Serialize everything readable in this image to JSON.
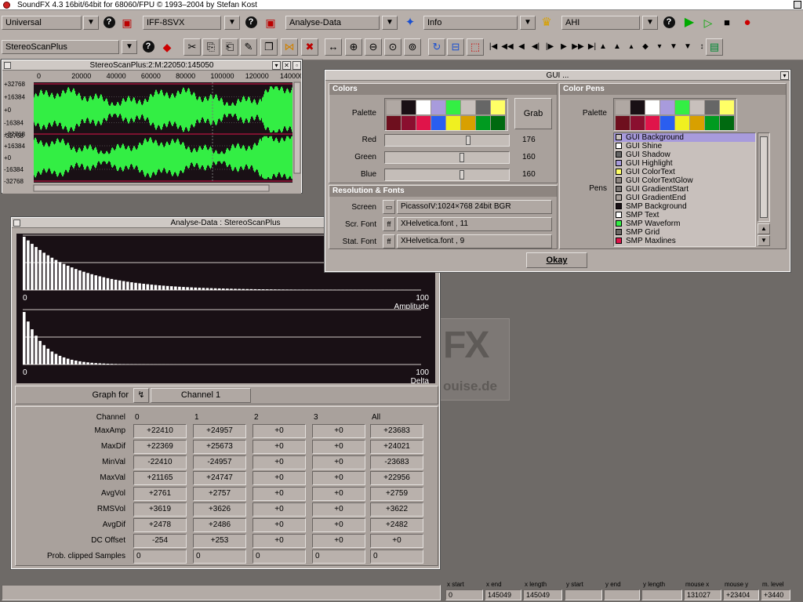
{
  "titlebar": {
    "title": "SoundFX  4.3 16bit/64bit for 68060/FPU © 1993–2004 by Stefan Kost"
  },
  "toolbar": {
    "universal": "Universal",
    "loader": "IFF-8SVX",
    "operator": "Analyse-Data",
    "info": "Info",
    "player": "AHI",
    "rexx": "StereoScanPlus"
  },
  "sample_window": {
    "title": "StereoScanPlus:2:M:22050:145050",
    "x_ticks": [
      "0",
      "20000",
      "40000",
      "60000",
      "80000",
      "100000",
      "120000",
      "140000"
    ],
    "y_ticks_ch1": [
      "+32768",
      "+16384",
      "+0",
      "-16384",
      "-32768"
    ],
    "y_ticks_ch2": [
      "+32768",
      "+16384",
      "+0",
      "-16384",
      "-32768"
    ],
    "waveform_color": "#33ee44"
  },
  "gui_window": {
    "title": "GUI ...",
    "colors": {
      "header": "Colors",
      "palette_label": "Palette",
      "grab_label": "Grab",
      "red_label": "Red",
      "red_value": "176",
      "red_level": 0.69,
      "green_label": "Green",
      "green_value": "160",
      "green_level": 0.63,
      "blue_label": "Blue",
      "blue_value": "160",
      "blue_level": 0.63
    },
    "palette": [
      "#b0a8a3",
      "#191015",
      "#ffffff",
      "#a89bdc",
      "#33ee44",
      "#c8c0bc",
      "#666666",
      "#ffff66",
      "#6e0f1e",
      "#8a0f2f",
      "#e0144a",
      "#2a5ef0",
      "#f0f020",
      "#d8a000",
      "#009b20",
      "#006a10"
    ],
    "resolution": {
      "header": "Resolution & Fonts",
      "screen_label": "Screen",
      "screen_value": "PicassoIV:1024×768 24bit BGR",
      "scr_font_label": "Scr. Font",
      "scr_font_value": "XHelvetica.font , 11",
      "stat_font_label": "Stat. Font",
      "stat_font_value": "XHelvetica.font , 9"
    },
    "color_pens": {
      "header": "Color Pens",
      "palette_label": "Palette",
      "pens_label": "Pens",
      "items": [
        {
          "name": "GUI Background",
          "color": "#c8c0bc"
        },
        {
          "name": "GUI Shine",
          "color": "#ffffff"
        },
        {
          "name": "GUI Shadow",
          "color": "#666666"
        },
        {
          "name": "GUI Highlight",
          "color": "#a89bdc"
        },
        {
          "name": "GUI ColorText",
          "color": "#ffff66"
        },
        {
          "name": "GUI ColorTextGlow",
          "color": "#8d8580"
        },
        {
          "name": "GUI GradientStart",
          "color": "#7a7572"
        },
        {
          "name": "GUI GradientEnd",
          "color": "#a9a19c"
        },
        {
          "name": "SMP Background",
          "color": "#191015"
        },
        {
          "name": "SMP Text",
          "color": "#ffffff"
        },
        {
          "name": "SMP Waveform",
          "color": "#33ee44"
        },
        {
          "name": "SMP Grid",
          "color": "#6e6a67"
        },
        {
          "name": "SMP Maxlines",
          "color": "#e0144a"
        }
      ]
    },
    "okay_label": "Okay"
  },
  "analyse_window": {
    "title": "Analyse-Data : StereoScanPlus",
    "graph1": {
      "min": "0",
      "max": "100",
      "label": "Amplitude"
    },
    "graph2": {
      "min": "0",
      "max": "100",
      "label": "Delta"
    },
    "graph_for_label": "Graph for",
    "channel_select": "Channel 1",
    "table": {
      "row_label_header": "Channel",
      "columns": [
        "0",
        "1",
        "2",
        "3",
        "All"
      ],
      "rows": [
        {
          "label": "MaxAmp",
          "values": [
            "+22410",
            "+24957",
            "+0",
            "+0",
            "+23683"
          ]
        },
        {
          "label": "MaxDif",
          "values": [
            "+22369",
            "+25673",
            "+0",
            "+0",
            "+24021"
          ]
        },
        {
          "label": "MinVal",
          "values": [
            "-22410",
            "-24957",
            "+0",
            "+0",
            "-23683"
          ]
        },
        {
          "label": "MaxVal",
          "values": [
            "+21165",
            "+24747",
            "+0",
            "+0",
            "+22956"
          ]
        },
        {
          "label": "AvgVol",
          "values": [
            "+2761",
            "+2757",
            "+0",
            "+0",
            "+2759"
          ]
        },
        {
          "label": "RMSVol",
          "values": [
            "+3619",
            "+3626",
            "+0",
            "+0",
            "+3622"
          ]
        },
        {
          "label": "AvgDif",
          "values": [
            "+2478",
            "+2486",
            "+0",
            "+0",
            "+2482"
          ]
        },
        {
          "label": "DC Offset",
          "values": [
            "-254",
            "+253",
            "+0",
            "+0",
            "+0"
          ]
        },
        {
          "label": "Prob. clipped Samples",
          "values": [
            "0",
            "0",
            "0",
            "0",
            "0"
          ]
        }
      ]
    }
  },
  "background_logo": {
    "text": "FX",
    "subtext": "ouise.de"
  },
  "statusbar": {
    "labels": [
      "x start",
      "x end",
      "x length",
      "y start",
      "y end",
      "y length",
      "mouse x",
      "mouse y",
      "m. level"
    ],
    "values": [
      "0",
      "145049",
      "145049",
      "",
      "",
      "",
      "131027",
      "+23404",
      "+3440"
    ]
  }
}
